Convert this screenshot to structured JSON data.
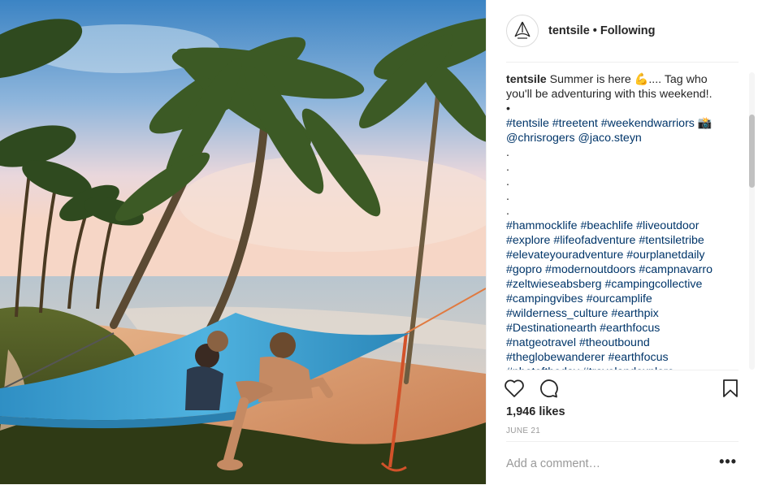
{
  "post": {
    "image_alt": "Three people relaxing in a blue tree tent hammock between palm trees on a tropical beach at sunset"
  },
  "header": {
    "username": "tentsile",
    "separator": "•",
    "follow_status": "Following",
    "avatar_icon": "tentsile-logo-icon"
  },
  "caption": {
    "username": "tentsile",
    "line1_text": "Summer is here 💪.... Tag who",
    "line2_text": "you'll be adventuring with this weekend!.",
    "bullet": "•",
    "tags_line1": [
      {
        "text": "#tentsile"
      },
      {
        "text": "#treetent"
      },
      {
        "text": "#weekendwarriors"
      }
    ],
    "tags_line1_suffix": "📸",
    "mentions": [
      {
        "text": "@chrisrogers"
      },
      {
        "text": "@jaco.steyn"
      }
    ],
    "dots": [
      ".",
      ".",
      ".",
      ".",
      "."
    ],
    "hashtag_lines": [
      [
        "#hammocklife",
        "#beachlife",
        "#liveoutdoor"
      ],
      [
        "#explore",
        "#lifeofadventure",
        "#tentsiletribe"
      ],
      [
        "#elevateyouradventure",
        "#ourplanetdaily"
      ],
      [
        "#gopro",
        "#modernoutdoors",
        "#campnavarro"
      ],
      [
        "#zeltwieseabsberg",
        "#campingcollective"
      ],
      [
        "#campingvibes",
        "#ourcamplife"
      ],
      [
        "#wilderness_culture",
        "#earthpix"
      ],
      [
        "#Destinationearth",
        "#earthfocus"
      ],
      [
        "#natgeotravel",
        "#theoutbound"
      ],
      [
        "#theglobewanderer",
        "#earthfocus"
      ],
      [
        "#photoftheday",
        "#travelandexplore"
      ]
    ]
  },
  "actions": {
    "like_icon": "heart-icon",
    "comment_icon": "comment-icon",
    "save_icon": "bookmark-icon"
  },
  "likes_text": "1,946 likes",
  "date_text": "JUNE 21",
  "comment": {
    "placeholder": "Add a comment…",
    "more_label": "•••"
  },
  "colors": {
    "tag": "#003569",
    "text": "#262626",
    "muted": "#999999",
    "hammock": "#3fa3d3"
  }
}
